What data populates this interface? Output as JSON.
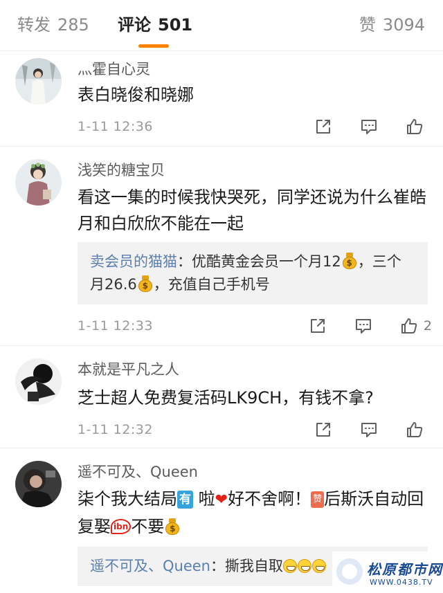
{
  "tabs": [
    {
      "label": "转发",
      "count": "285"
    },
    {
      "label": "评论",
      "count": "501"
    },
    {
      "label": "赞",
      "count": "3094"
    }
  ],
  "active_tab": "评论",
  "accent_color": "#ff8200",
  "comments": [
    {
      "username": "灬霍自心灵",
      "text": "表白晓俊和晓娜",
      "time": "1-11  12:36",
      "like_count": ""
    },
    {
      "username": "浅笑的糖宝贝",
      "text": "看这一集的时候我快哭死，同学还说为什么崔皓月和白欣欣不能在一起",
      "time": "1-11  12:33",
      "like_count": "2",
      "reply": {
        "user": "卖会员的猫猫",
        "text_1": "：优酷黄金会员一个月12",
        "text_2": "，三个月26.6",
        "text_3": "，充值自己手机号"
      }
    },
    {
      "username": "本就是平凡之人",
      "text": "芝士超人免费复活码LK9CH，有钱不拿?",
      "time": "1-11  12:32",
      "like_count": ""
    },
    {
      "username": "遥不可及、Queen",
      "text_1": "柒个我大结局",
      "emoji_you": "有",
      "text_2": " 啦",
      "text_3": "好不舍啊！",
      "emoji_zan": "赞",
      "text_4": "后斯沃自动回复娶",
      "emoji_hu": "ibn",
      "text_5": "不要",
      "reply": {
        "user": "遥不可及、Queen",
        "text": "：撕我自取"
      }
    }
  ],
  "icons": {
    "share": "share-icon",
    "comment": "comment-icon",
    "like": "thumbs-up-icon",
    "money_bag": "money-bag-emoji"
  },
  "watermark": {
    "title": "松原都市网",
    "url": "WWW.0438.TV"
  }
}
